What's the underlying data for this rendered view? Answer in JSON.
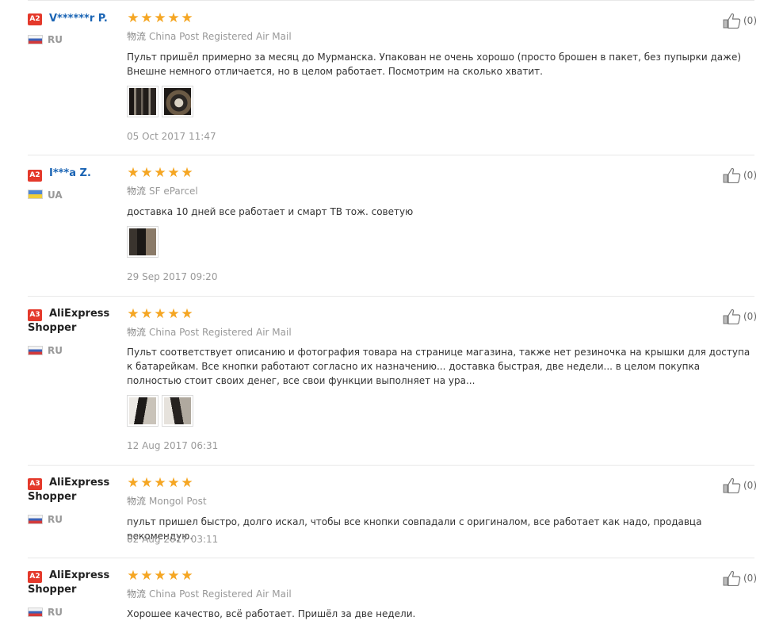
{
  "reviews": [
    {
      "level": "A2",
      "user": "V******r P.",
      "country": "RU",
      "flag": "ru",
      "stars": 5,
      "logistics_label": "物流",
      "logistics": "China Post Registered Air Mail",
      "text": "Пульт пришёл примерно за месяц до Мурманска. Упакован не очень хорошо (просто брошен в пакет, без пупырки даже) Внешне немного отличается, но в целом работает. Посмотрим на сколько хватит.",
      "photos": 2,
      "date": "05 Oct 2017 11:47",
      "likes": "(0)"
    },
    {
      "level": "A2",
      "user": "I***a Z.",
      "country": "UA",
      "flag": "ua",
      "stars": 5,
      "logistics_label": "物流",
      "logistics": "SF eParcel",
      "text": "доставка 10 дней все работает и смарт ТВ тож. советую",
      "photos": 1,
      "date": "29 Sep 2017 09:20",
      "likes": "(0)"
    },
    {
      "level": "A3",
      "user": "AliExpress Shopper",
      "country": "RU",
      "flag": "ru",
      "stars": 5,
      "logistics_label": "物流",
      "logistics": "China Post Registered Air Mail",
      "text": "Пульт соответствует описанию и фотография товара на странице магазина, также нет резиночка на крышки для доступа к батарейкам. Все кнопки работают согласно их назначению... доставка быстрая, две недели... в целом покупка полностью стоит своих денег, все свои функции выполняет на ура...",
      "photos": 2,
      "date": "12 Aug 2017 06:31",
      "likes": "(0)"
    },
    {
      "level": "A3",
      "user": "AliExpress Shopper",
      "country": "RU",
      "flag": "ru",
      "stars": 5,
      "logistics_label": "物流",
      "logistics": "Mongol Post",
      "text": "пульт пришел быстро, долго искал, чтобы все кнопки совпадали с оригиналом, все работает как надо, продавца рекомендую.",
      "photos": 0,
      "date": "02 Aug 2017 03:11",
      "likes": "(0)"
    },
    {
      "level": "A2",
      "user": "AliExpress Shopper",
      "country": "RU",
      "flag": "ru",
      "stars": 5,
      "logistics_label": "物流",
      "logistics": "China Post Registered Air Mail",
      "text": "Хорошее качество, всё работает. Пришёл за две недели.",
      "photos": 0,
      "date": "",
      "likes": "(0)"
    }
  ],
  "colors": {
    "badge": "#e4392b",
    "username": "#1a64b4",
    "star": "#f5a623"
  },
  "icons": {
    "star": "star-icon",
    "like": "thumbs-up-icon"
  }
}
